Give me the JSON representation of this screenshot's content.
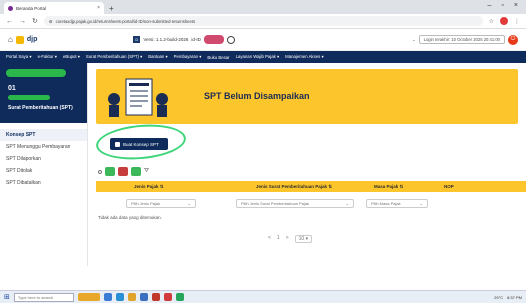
{
  "browser": {
    "tab_title": "Beranda Portal",
    "new_tab": "+",
    "url": "coretaxdjp.pajak.go.id/returnsheets-portal/id-ID/non-submitted-returnsheets",
    "window_controls": [
      "–",
      "▫",
      "×"
    ]
  },
  "header": {
    "logo": "djp",
    "version_label": "Versi: 1.1.2-build-2026",
    "lang": "id-ID",
    "login_text": "Login terakhir: 10 October 2025 20:41:00"
  },
  "navbar": {
    "items": [
      "Portal Saya ▾",
      "e-Faktur ▾",
      "eBupot ▾",
      "Surat Pemberitahuan (SPT) ▾",
      "Bantuan ▾",
      "Pembayaran ▾",
      "Buku Besar",
      "Layanan Wajib Pajak ▾",
      "Manajemen Akses ▾"
    ]
  },
  "sidebar": {
    "profile_number": "01",
    "profile_label": "Surat Pemberitahuan (SPT)",
    "items": [
      {
        "label": "Konsep SPT",
        "active": true
      },
      {
        "label": "SPT Menunggu Pembayaran",
        "active": false
      },
      {
        "label": "SPT Dilaporkan",
        "active": false
      },
      {
        "label": "SPT Ditolak",
        "active": false
      },
      {
        "label": "SPT Dibatalkan",
        "active": false
      }
    ]
  },
  "main": {
    "banner_title": "SPT Belum Disampaikan",
    "create_button": "Buat Konsep SPT",
    "filter_icon": "filter-icon",
    "columns": [
      "Jenis Pajak ⇅",
      "Jenis Surat Pemberitahuan Pajak ⇅",
      "Masa Pajak ⇅",
      "NOP"
    ],
    "filters": [
      "Pilih Jenis Pajak",
      "Pilih Jenis Surat Pemberitahuan Pajak",
      "Pilih Masa Pajak"
    ],
    "empty_text": "Tidak ada data yang ditemukan.",
    "pager_prev": "<",
    "pager_page": "1",
    "pager_next": ">",
    "page_size": "10 ▾"
  },
  "taskbar": {
    "search_placeholder": "Type here to search",
    "weather": "29°C",
    "time": "8:37 PM"
  },
  "colors": {
    "navy": "#0e2b5c",
    "yellow": "#fdc52c",
    "green_annotation": "#3fd57a"
  }
}
